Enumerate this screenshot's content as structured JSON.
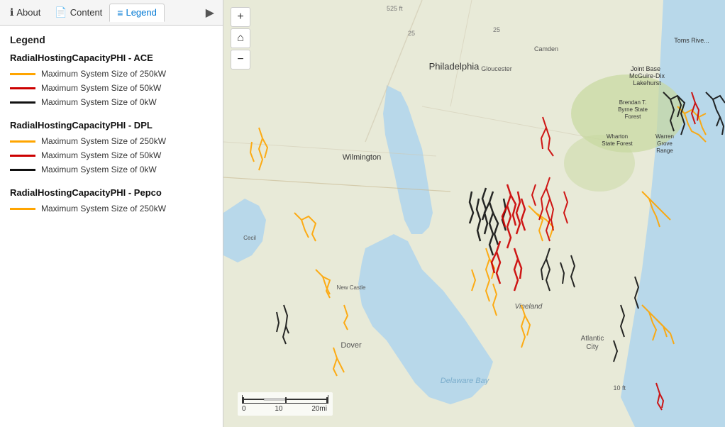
{
  "tabs": [
    {
      "label": "About",
      "icon": "ℹ",
      "active": false,
      "name": "tab-about"
    },
    {
      "label": "Content",
      "icon": "📄",
      "active": false,
      "name": "tab-content"
    },
    {
      "label": "Legend",
      "icon": "≡",
      "active": true,
      "name": "tab-legend"
    }
  ],
  "legend": {
    "title": "Legend",
    "sections": [
      {
        "title": "RadialHostingCapacityPHI - ACE",
        "items": [
          {
            "color": "#FFA500",
            "label": "Maximum System Size of 250kW"
          },
          {
            "color": "#CC0000",
            "label": "Maximum System Size of 50kW"
          },
          {
            "color": "#111111",
            "label": "Maximum System Size of 0kW"
          }
        ]
      },
      {
        "title": "RadialHostingCapacityPHI - DPL",
        "items": [
          {
            "color": "#FFA500",
            "label": "Maximum System Size of 250kW"
          },
          {
            "color": "#CC0000",
            "label": "Maximum System Size of 50kW"
          },
          {
            "color": "#111111",
            "label": "Maximum System Size of 0kW"
          }
        ]
      },
      {
        "title": "RadialHostingCapacityPHI - Pepco",
        "items": [
          {
            "color": "#FFA500",
            "label": "Maximum System Size of 250kW"
          }
        ]
      }
    ]
  },
  "map": {
    "controls": {
      "zoom_in": "+",
      "home": "⌂",
      "zoom_out": "−"
    },
    "scale": {
      "labels": [
        "0",
        "10",
        "20mi"
      ]
    }
  }
}
